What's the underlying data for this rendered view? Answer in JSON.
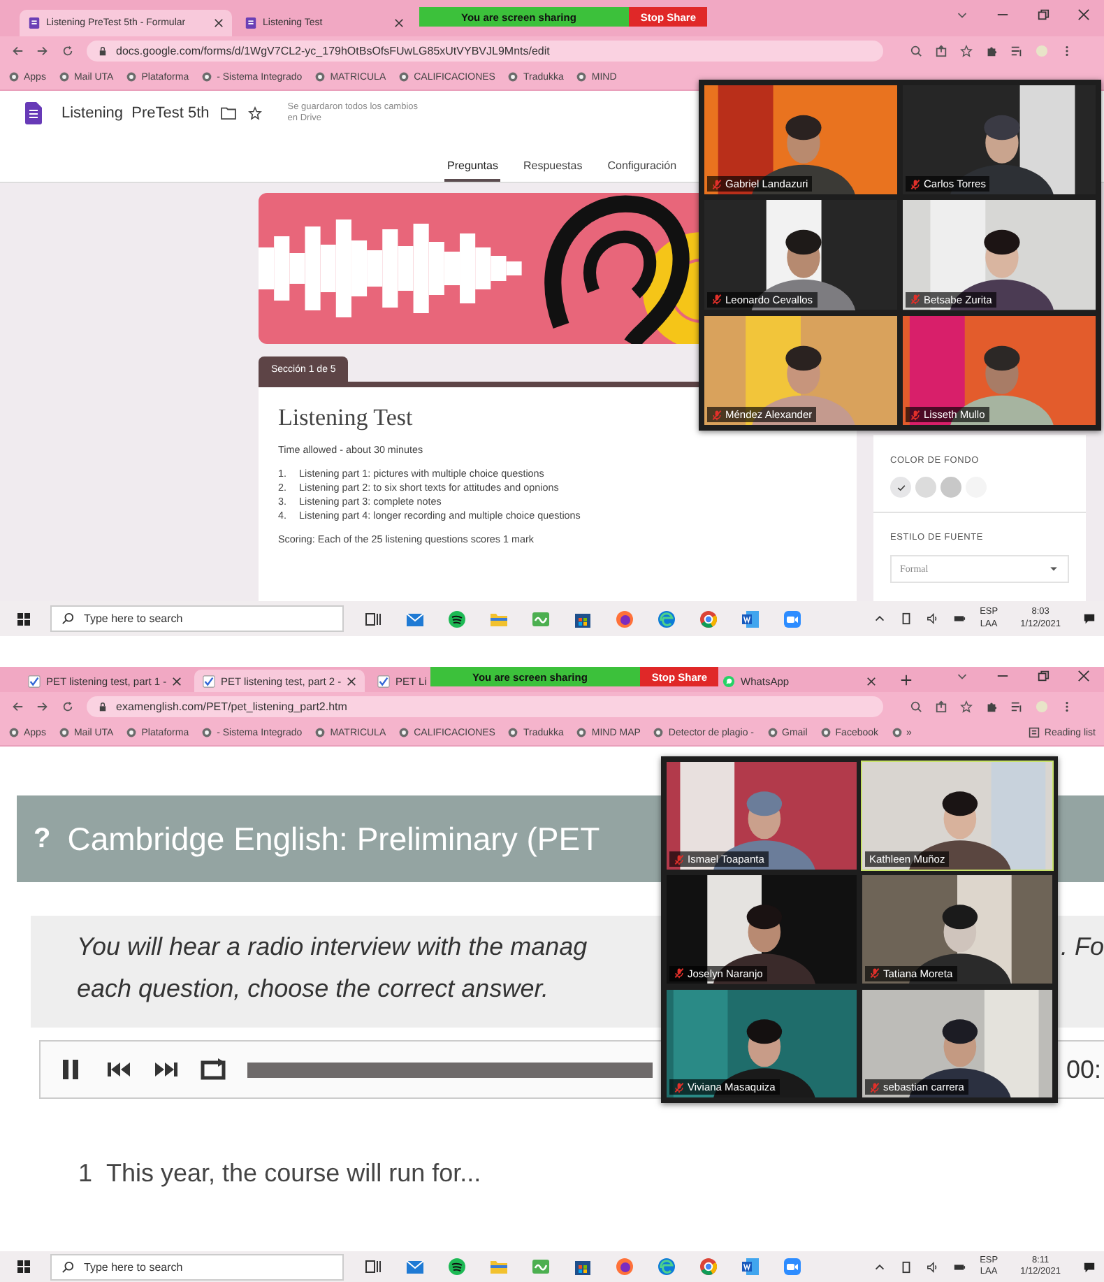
{
  "screens": [
    {
      "tabs": [
        {
          "kind": "form",
          "label": "Listening PreTest 5th - Formular",
          "selected": true
        },
        {
          "kind": "form",
          "label": "Listening Test",
          "selected": false
        }
      ],
      "share_banner": {
        "label": "You are screen sharing",
        "button": "Stop Share"
      },
      "url": "docs.google.com/forms/d/1WgV7CL2-yc_179hOtBsOfsFUwLG85xUtVYBVJL9Mnts/edit",
      "bookmarks": [
        "Apps",
        "Mail UTA",
        "Plataforma",
        "- Sistema Integrado",
        "MATRICULA",
        "CALIFICACIONES",
        "Tradukka",
        "MIND"
      ],
      "page": {
        "kind": "form",
        "title": "Listening  PreTest 5th",
        "save_status": "Se guardaron todos los cambios en Drive",
        "tabs": [
          {
            "label": "Preguntas",
            "selected": true
          },
          {
            "label": "Respuestas",
            "selected": false
          },
          {
            "label": "Configuración",
            "selected": false
          }
        ],
        "section_label": "Sección 1 de 5",
        "form_title": "Listening Test",
        "description": "Time allowed - about 30 minutes",
        "parts": [
          {
            "number": "1.",
            "text": "Listening part 1: pictures with multiple choice questions"
          },
          {
            "number": "2.",
            "text": "Listening part 2: to six short texts for attitudes and opnions"
          },
          {
            "number": "3.",
            "text": "Listening part 3: complete notes"
          },
          {
            "number": "4.",
            "text": "Listening part 4: longer recording and multiple choice questions"
          }
        ],
        "scoring": "Scoring: Each of the 25 listening questions scores 1 mark",
        "color_heading": "COLOR DE FONDO",
        "swatches": [
          {
            "color": "#e6e6e8",
            "selected": true
          },
          {
            "color": "#dcdcdc",
            "selected": false
          },
          {
            "color": "#c8c8c8",
            "selected": false
          },
          {
            "color": "#f4f4f4",
            "selected": false
          }
        ],
        "font_heading": "ESTILO DE FUENTE",
        "font_value": "Formal"
      },
      "video_tiles": [
        {
          "name": "Gabriel Landazuri",
          "muted": true,
          "speaking": false
        },
        {
          "name": "Carlos Torres",
          "muted": true,
          "speaking": false
        },
        {
          "name": "Leonardo Cevallos",
          "muted": true,
          "speaking": false
        },
        {
          "name": "Betsabe Zurita",
          "muted": true,
          "speaking": false
        },
        {
          "name": "Méndez Alexander",
          "muted": true,
          "speaking": false
        },
        {
          "name": "Lisseth Mullo",
          "muted": true,
          "speaking": false
        }
      ],
      "taskbar": {
        "search_placeholder": "Type here to search",
        "language": "ESP",
        "layout": "LAA",
        "time": "8:03",
        "date": "1/12/2021"
      }
    },
    {
      "tabs": [
        {
          "kind": "check",
          "label": "PET listening test, part 1 -",
          "selected": false
        },
        {
          "kind": "check",
          "label": "PET listening test, part 2 -",
          "selected": true
        },
        {
          "kind": "check",
          "label": "PET Li",
          "selected": false
        },
        {
          "kind": "chat",
          "label": "WhatsApp",
          "selected": false
        }
      ],
      "share_banner": {
        "label": "You are screen sharing",
        "button": "Stop Share"
      },
      "url": "examenglish.com/PET/pet_listening_part2.htm",
      "bookmarks": [
        "Apps",
        "Mail UTA",
        "Plataforma",
        "- Sistema Integrado",
        "MATRICULA",
        "CALIFICACIONES",
        "Tradukka",
        "MIND MAP",
        "Detector de plagio -",
        "Gmail",
        "Facebook",
        "»"
      ],
      "reading_list": "Reading list",
      "page": {
        "kind": "exam",
        "heading_icon": "?",
        "heading": "Cambridge English: Preliminary (PET",
        "instruction_lines": [
          "You will hear a radio interview with the manag",
          "each question, choose the correct answer."
        ],
        "instruction_tail": ". Fo",
        "player_time": "00:",
        "question_number": "1",
        "question": "This year, the course will run for..."
      },
      "video_tiles": [
        {
          "name": "Ismael Toapanta",
          "muted": true,
          "speaking": false
        },
        {
          "name": "Kathleen Muñoz",
          "muted": false,
          "speaking": true
        },
        {
          "name": "Joselyn Naranjo",
          "muted": true,
          "speaking": false
        },
        {
          "name": "Tatiana Moreta",
          "muted": true,
          "speaking": false
        },
        {
          "name": "Viviana Masaquiza",
          "muted": true,
          "speaking": false
        },
        {
          "name": "sebastian carrera",
          "muted": true,
          "speaking": false
        }
      ],
      "taskbar": {
        "search_placeholder": "Type here to search",
        "language": "ESP",
        "layout": "LAA",
        "time": "8:11",
        "date": "1/12/2021"
      }
    }
  ]
}
